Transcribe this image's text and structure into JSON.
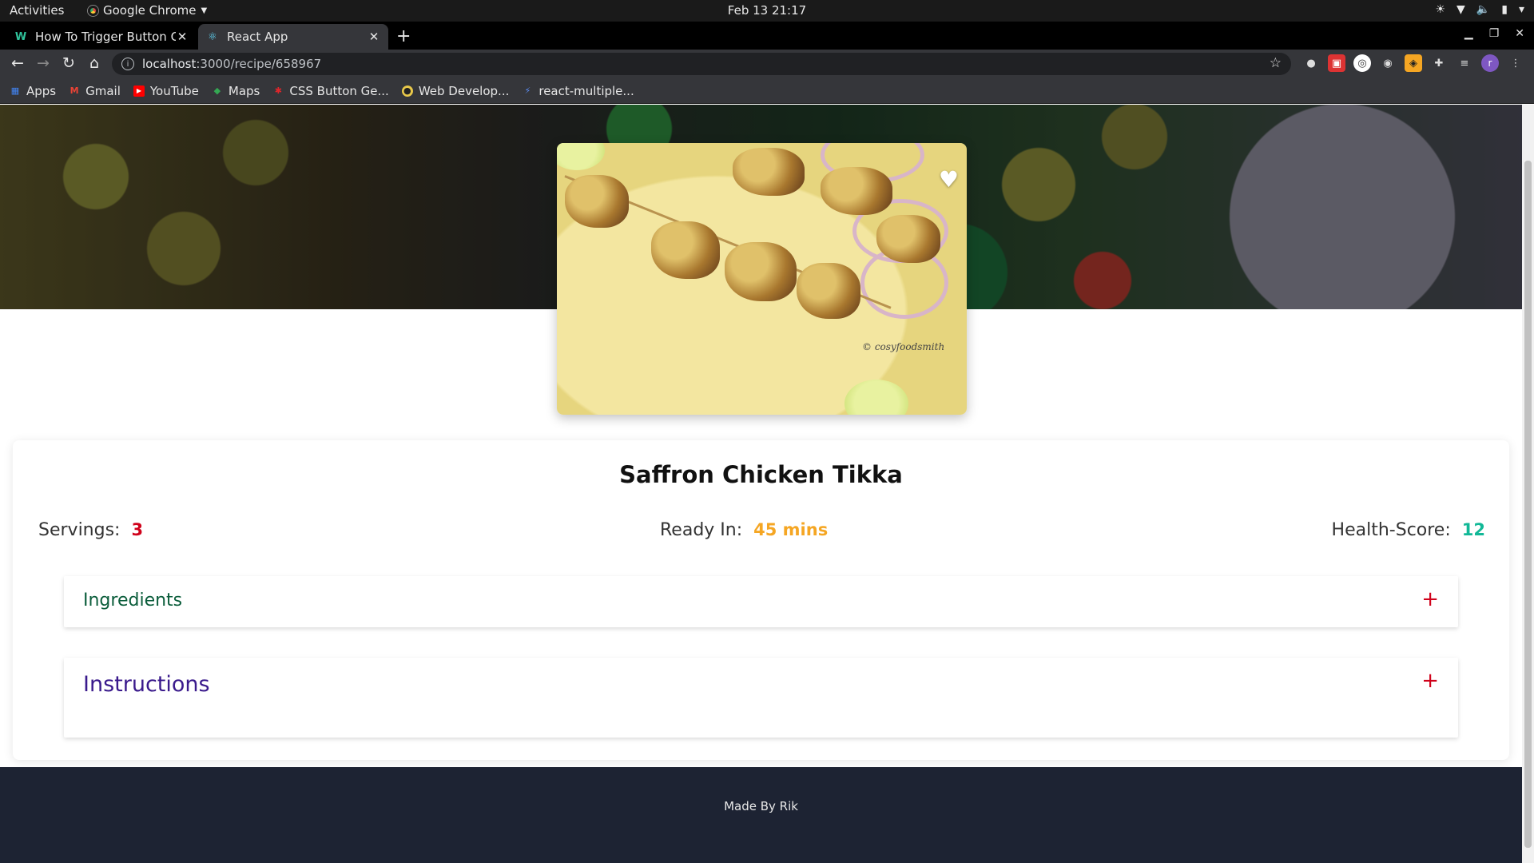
{
  "system_bar": {
    "activities": "Activities",
    "app_name": "Google Chrome",
    "clock": "Feb 13  21:17"
  },
  "browser": {
    "tabs": [
      {
        "title": "How To Trigger Button Cl",
        "favicon": "w-icon",
        "active": false
      },
      {
        "title": "React App",
        "favicon": "react-icon",
        "active": true
      }
    ],
    "url": {
      "host": "localhost",
      "path": ":3000/recipe/658967"
    },
    "bookmarks": [
      {
        "label": "Apps",
        "icon": "apps-grid-icon",
        "color": "#4285f4"
      },
      {
        "label": "Gmail",
        "icon": "gmail-icon",
        "color": "#ea4335"
      },
      {
        "label": "YouTube",
        "icon": "youtube-icon",
        "color": "#ff0000"
      },
      {
        "label": "Maps",
        "icon": "maps-icon",
        "color": "#34a853"
      },
      {
        "label": "CSS Button Ge...",
        "icon": "css-icon",
        "color": "#e0262b"
      },
      {
        "label": "Web Develop...",
        "icon": "web-dev-icon",
        "color": "#e8c84a"
      },
      {
        "label": "react-multiple...",
        "icon": "bolt-icon",
        "color": "#5b8cf2"
      }
    ],
    "avatar_letter": "r"
  },
  "recipe": {
    "title": "Saffron Chicken Tikka",
    "photo_watermark": "© cosyfoodsmith",
    "servings_label": "Servings:",
    "servings_value": "3",
    "ready_label": "Ready In:",
    "ready_value": "45 mins",
    "health_label": "Health-Score:",
    "health_value": "12",
    "sections": [
      {
        "label": "Ingredients",
        "toggle": "+",
        "color": "#0b5d3b"
      },
      {
        "label": "Instructions",
        "toggle": "+",
        "color": "#3a1a8c"
      }
    ]
  },
  "footer": {
    "text": "Made By Rik"
  }
}
